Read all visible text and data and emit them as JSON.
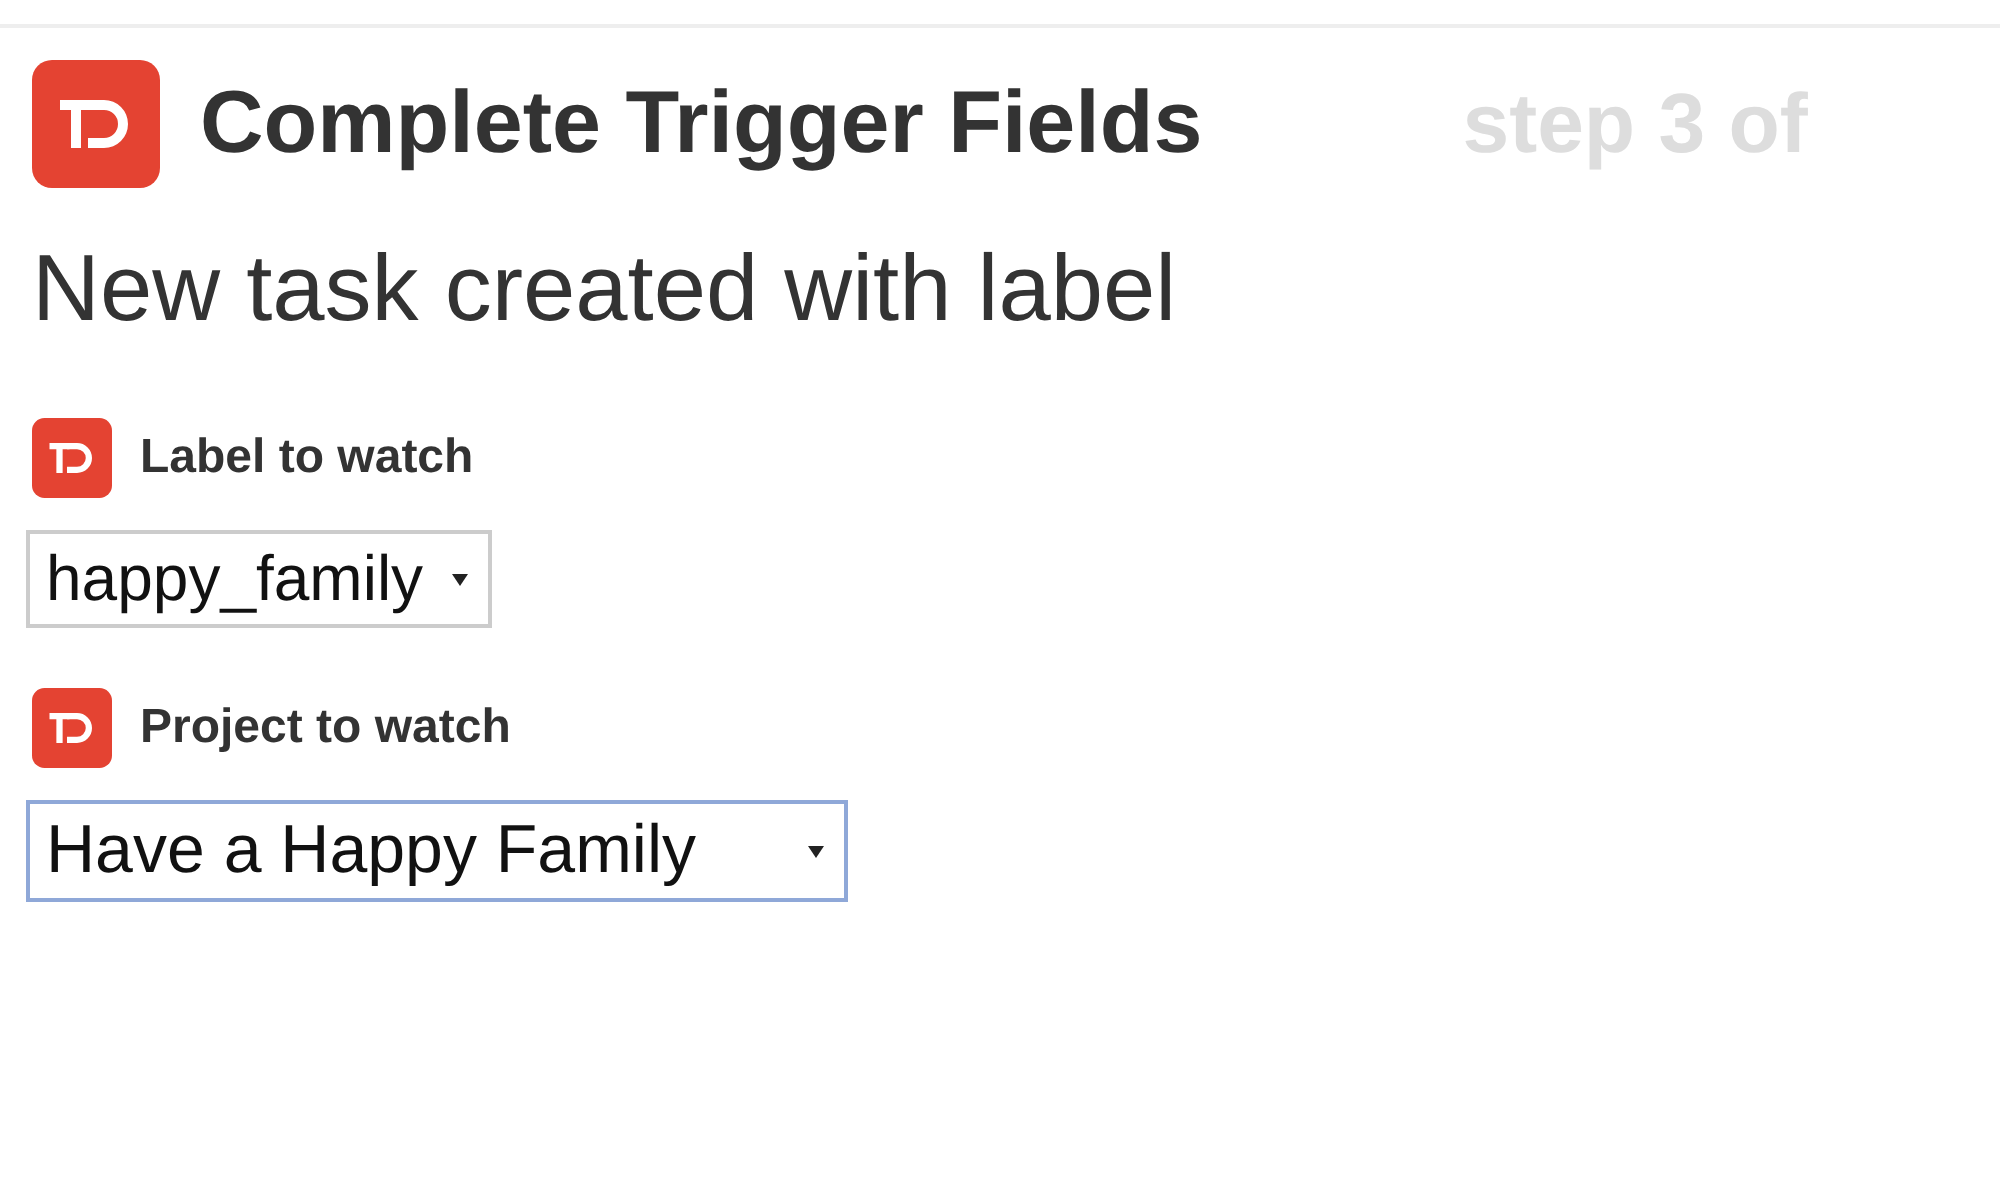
{
  "header": {
    "title": "Complete Trigger Fields",
    "step": "step 3 of"
  },
  "trigger": {
    "name": "New task created with label"
  },
  "fields": [
    {
      "label": "Label to watch",
      "value": "happy_family",
      "focused": false
    },
    {
      "label": "Project to watch",
      "value": "Have a Happy Family",
      "focused": true
    }
  ]
}
